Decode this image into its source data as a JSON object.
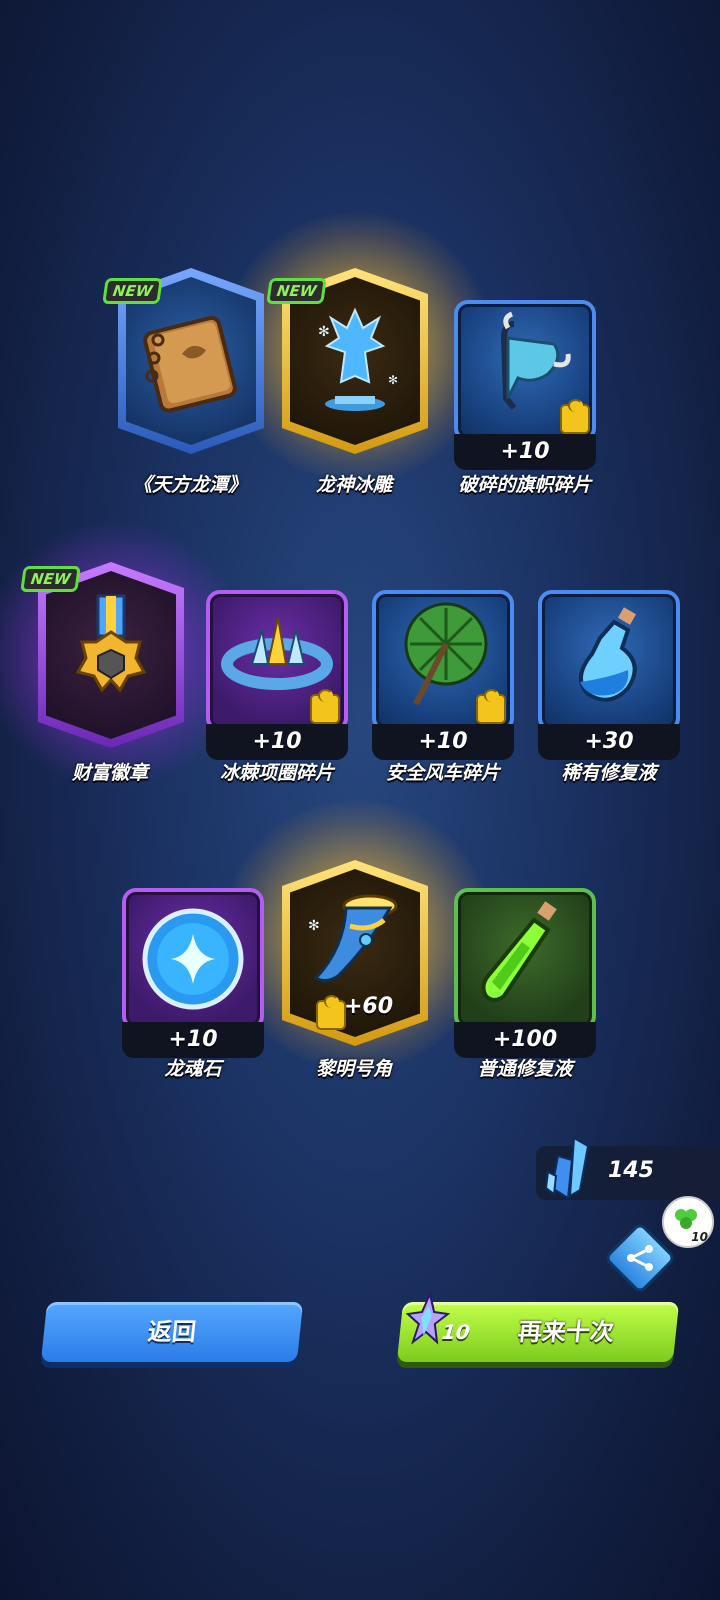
{
  "row1": [
    {
      "name": "《天方龙潭》",
      "badge": "NEW",
      "frame": "blue-hex",
      "icon": "ancient-book-icon"
    },
    {
      "name": "龙神冰雕",
      "badge": "NEW",
      "frame": "gold-hex",
      "icon": "ice-dragon-statue-icon"
    },
    {
      "name": "破碎的旗帜碎片",
      "count": "+10",
      "frame": "blue",
      "icon": "banner-fragment-icon"
    }
  ],
  "row2": [
    {
      "name": "财富徽章",
      "badge": "NEW",
      "frame": "purple-hex",
      "icon": "wealth-medal-icon"
    },
    {
      "name": "冰棘项圈碎片",
      "count": "+10",
      "frame": "purple",
      "icon": "ice-collar-icon"
    },
    {
      "name": "安全风车碎片",
      "count": "+10",
      "frame": "blue",
      "icon": "windmill-icon"
    },
    {
      "name": "稀有修复液",
      "count": "+30",
      "frame": "blue",
      "icon": "blue-potion-icon"
    }
  ],
  "row3": [
    {
      "name": "龙魂石",
      "count": "+10",
      "frame": "purple",
      "icon": "dragon-soul-stone-icon"
    },
    {
      "name": "黎明号角",
      "count": "+60",
      "frame": "gold-hex",
      "icon": "dawn-horn-icon"
    },
    {
      "name": "普通修复液",
      "count": "+100",
      "frame": "green",
      "icon": "green-potion-icon"
    }
  ],
  "currency": {
    "value": "145",
    "icon": "crystal-icon"
  },
  "share": {
    "badge_count": "10",
    "icon": "share-icon"
  },
  "buttons": {
    "back_label": "返回",
    "again_label": "再来十次",
    "again_cost": "10"
  },
  "colors": {
    "gold": "#ffd23c",
    "purple": "#b35ef0",
    "blue": "#4c8cf0",
    "green": "#5cc04a"
  }
}
